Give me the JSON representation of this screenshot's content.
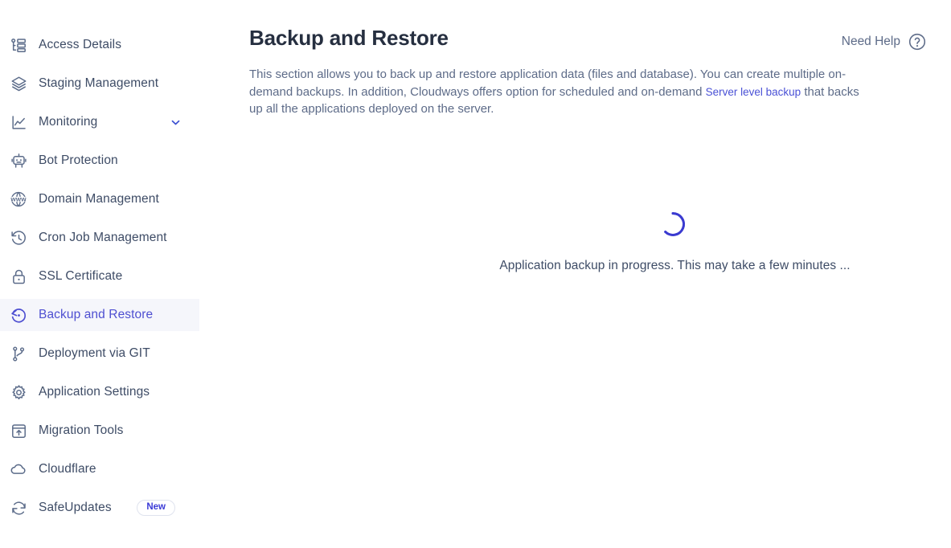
{
  "sidebar": {
    "items": [
      {
        "label": "Access Details",
        "icon": "access-details-icon",
        "active": false,
        "chevron": false,
        "badge": null
      },
      {
        "label": "Staging Management",
        "icon": "layers-icon",
        "active": false,
        "chevron": false,
        "badge": null
      },
      {
        "label": "Monitoring",
        "icon": "chart-line-icon",
        "active": false,
        "chevron": true,
        "badge": null
      },
      {
        "label": "Bot Protection",
        "icon": "robot-icon",
        "active": false,
        "chevron": false,
        "badge": null
      },
      {
        "label": "Domain Management",
        "icon": "www-globe-icon",
        "active": false,
        "chevron": false,
        "badge": null
      },
      {
        "label": "Cron Job Management",
        "icon": "clock-history-icon",
        "active": false,
        "chevron": false,
        "badge": null
      },
      {
        "label": "SSL Certificate",
        "icon": "lock-icon",
        "active": false,
        "chevron": false,
        "badge": null
      },
      {
        "label": "Backup and Restore",
        "icon": "restore-icon",
        "active": true,
        "chevron": false,
        "badge": null
      },
      {
        "label": "Deployment via GIT",
        "icon": "git-branch-icon",
        "active": false,
        "chevron": false,
        "badge": null
      },
      {
        "label": "Application Settings",
        "icon": "gear-icon",
        "active": false,
        "chevron": false,
        "badge": null
      },
      {
        "label": "Migration Tools",
        "icon": "migration-upload-icon",
        "active": false,
        "chevron": false,
        "badge": null
      },
      {
        "label": "Cloudflare",
        "icon": "cloud-icon",
        "active": false,
        "chevron": false,
        "badge": null
      },
      {
        "label": "SafeUpdates",
        "icon": "refresh-sync-icon",
        "active": false,
        "chevron": false,
        "badge": "New"
      }
    ]
  },
  "header": {
    "title": "Backup and Restore",
    "need_help_label": "Need Help",
    "help_icon": "question-circle-icon"
  },
  "description": {
    "part1": "This section allows you to back up and restore application data (files and database). You can create multiple on-demand backups. In addition, Cloudways offers option for scheduled and on-demand ",
    "link_text": "Server level backup",
    "part2": " that backs up all the applications deployed on the server."
  },
  "loading": {
    "message": "Application backup in progress. This may take a few minutes ...",
    "spinner_icon": "loading-spinner-icon"
  },
  "colors": {
    "accent": "#4e4fd1",
    "spinner": "#3a3ad0",
    "active_bg": "#f5f6fb",
    "heading": "#262f40",
    "body_text": "#5d6b88",
    "nav_text": "#3e4c66",
    "icon": "#5c6c8a",
    "badge_text": "#3a3ad6",
    "badge_border": "#dfe3ee"
  }
}
